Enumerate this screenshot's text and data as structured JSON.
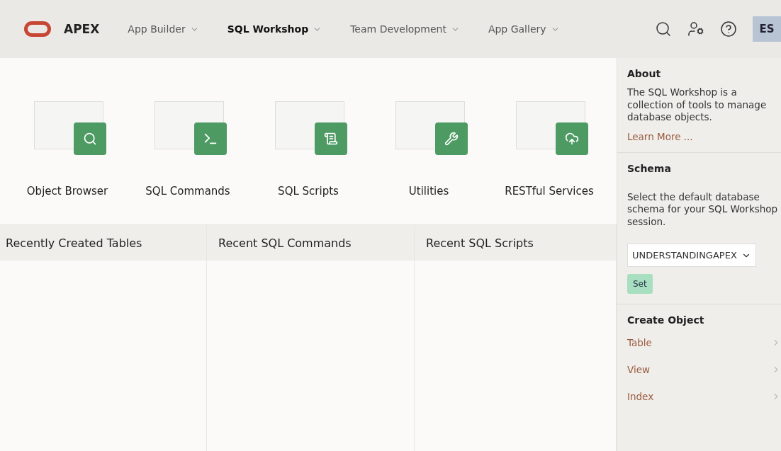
{
  "header": {
    "brand": "APEX",
    "nav": [
      {
        "label": "App Builder",
        "selected": false
      },
      {
        "label": "SQL Workshop",
        "selected": true
      },
      {
        "label": "Team Development",
        "selected": false
      },
      {
        "label": "App Gallery",
        "selected": false
      }
    ],
    "avatar": "ES"
  },
  "tools": [
    {
      "label": "Object Browser",
      "kind": "search"
    },
    {
      "label": "SQL Commands",
      "kind": "terminal"
    },
    {
      "label": "SQL Scripts",
      "kind": "scroll"
    },
    {
      "label": "Utilities",
      "kind": "wrench"
    },
    {
      "label": "RESTful Services",
      "kind": "cloud"
    }
  ],
  "recent": [
    "Recently Created Tables",
    "Recent SQL Commands",
    "Recent SQL Scripts"
  ],
  "sidebar": {
    "about": {
      "title": "About",
      "text": "The SQL Workshop is a collection of tools to manage database objects.",
      "link": "Learn More ..."
    },
    "schema": {
      "title": "Schema",
      "text": "Select the default database schema for your SQL Workshop session.",
      "value": "UNDERSTANDINGAPEX",
      "button": "Set"
    },
    "create": {
      "title": "Create Object",
      "items": [
        "Table",
        "View",
        "Index"
      ]
    }
  }
}
